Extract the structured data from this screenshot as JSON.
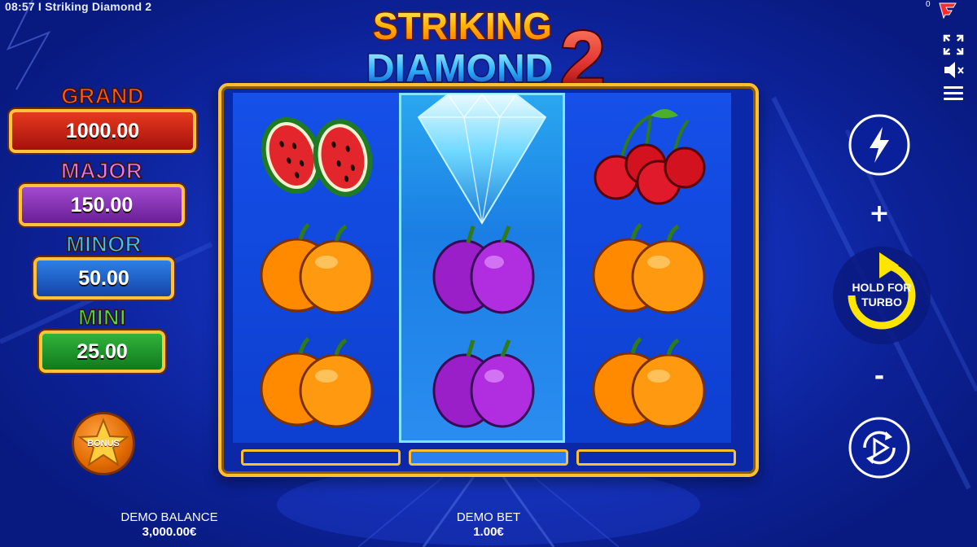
{
  "status_bar": {
    "time": "08:57",
    "separator": "I",
    "game_title": "Striking Diamond 2"
  },
  "provider": {
    "counter": "0"
  },
  "logo": {
    "line1": "STRIKING",
    "line2": "DIAMOND",
    "number": "2"
  },
  "jackpots": [
    {
      "name": "GRAND",
      "value": "1000.00",
      "color": "#e63a1f"
    },
    {
      "name": "MAJOR",
      "value": "150.00",
      "color": "#a24bd0"
    },
    {
      "name": "MINOR",
      "value": "50.00",
      "color": "#2d7fe6"
    },
    {
      "name": "MINI",
      "value": "25.00",
      "color": "#32b23b"
    }
  ],
  "bonus_button": {
    "label": "BONUS"
  },
  "reels": [
    {
      "symbols": [
        "watermelon",
        "orange",
        "orange"
      ]
    },
    {
      "symbols": [
        "diamond",
        "plum",
        "plum"
      ]
    },
    {
      "symbols": [
        "cherry",
        "orange",
        "orange"
      ]
    }
  ],
  "controls": {
    "fullscreen": "fullscreen-icon",
    "sound": "mute-icon",
    "menu": "menu-icon",
    "quick": "lightning-icon",
    "plus": "+",
    "minus": "-",
    "spin": {
      "line1": "HOLD FOR",
      "line2": "TURBO"
    },
    "autoplay": "autoplay-icon"
  },
  "footer": {
    "balance_label": "DEMO BALANCE",
    "balance_value": "3,000.00€",
    "bet_label": "DEMO BET",
    "bet_value": "1.00€"
  },
  "colors": {
    "frame": "#ffbf2e",
    "background": "#1330b8"
  }
}
